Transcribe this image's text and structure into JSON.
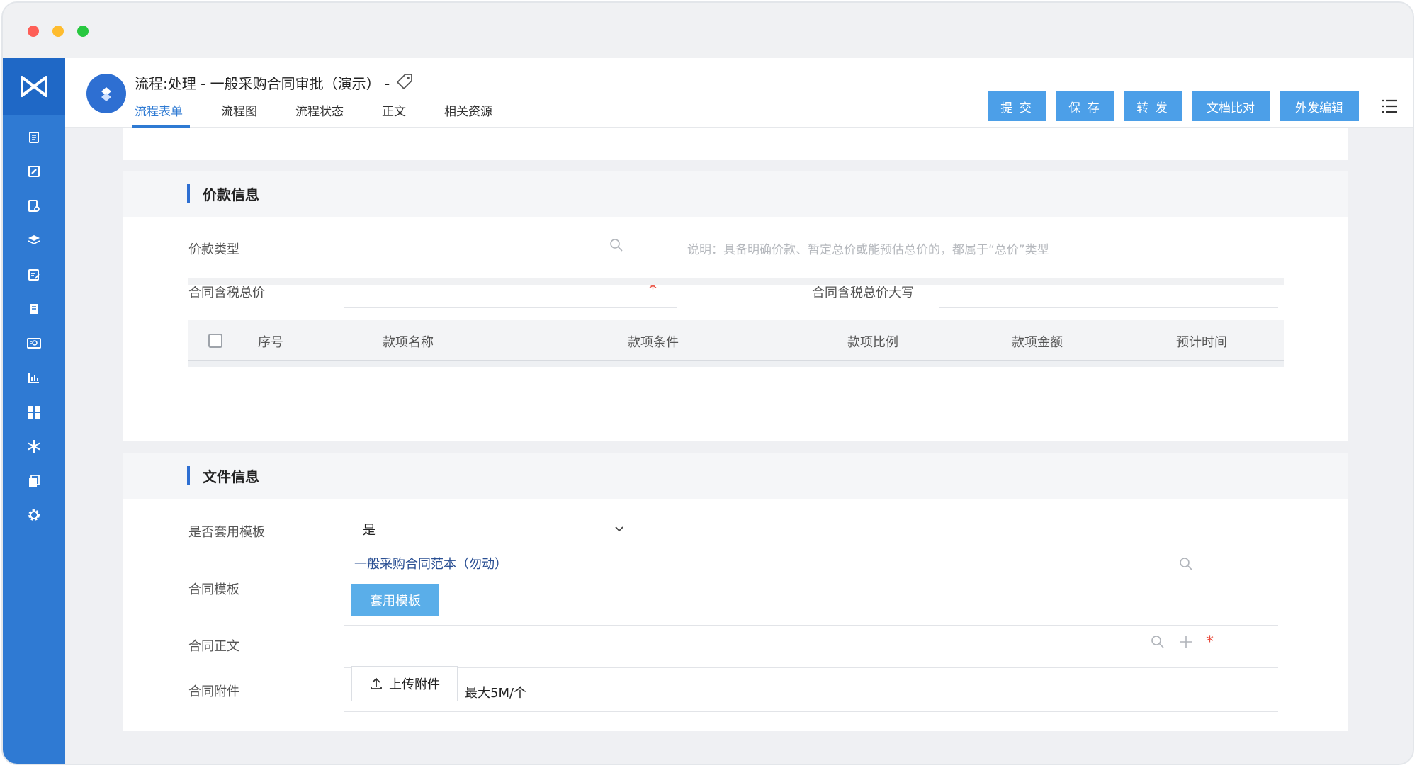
{
  "header": {
    "title": "流程:处理 - 一般采购合同审批（演示） -",
    "tabs": [
      {
        "label": "流程表单",
        "active": true
      },
      {
        "label": "流程图"
      },
      {
        "label": "流程状态"
      },
      {
        "label": "正文"
      },
      {
        "label": "相关资源"
      }
    ],
    "buttons": [
      {
        "label": "提 交"
      },
      {
        "label": "保 存"
      },
      {
        "label": "转 发"
      },
      {
        "label": "文档比对"
      },
      {
        "label": "外发编辑"
      }
    ]
  },
  "price_section": {
    "title": "价款信息",
    "price_type_label": "价款类型",
    "price_type_hint": "说明：具备明确价款、暂定总价或能预估总价的，都属于“总价”类型",
    "total_label": "合同含税总价",
    "total_upper_label": "合同含税总价大写",
    "required_mark": "*",
    "table_columns": [
      "序号",
      "款项名称",
      "款项条件",
      "款项比例",
      "款项金额",
      "预计时间"
    ]
  },
  "file_section": {
    "title": "文件信息",
    "use_template_label": "是否套用模板",
    "use_template_value": "是",
    "template_label": "合同模板",
    "template_value": "一般采购合同范本（勿动）",
    "apply_template_button": "套用模板",
    "body_label": "合同正文",
    "required_mark": "*",
    "attachment_label": "合同附件",
    "upload_button": "上传附件",
    "upload_limit": "最大5M/个"
  },
  "colors": {
    "sidebar": "#2f7ad3",
    "accent": "#2e7ad3",
    "button": "#4c9fe8",
    "required": "#e94a3b"
  },
  "sidebar_icons": [
    "doc-icon",
    "edit-icon",
    "doc-search-icon",
    "layers-icon",
    "edit-note-icon",
    "book-icon",
    "monitor-search-icon",
    "bar-chart-icon",
    "grid-icon",
    "snowflake-icon",
    "copy-icon",
    "settings-icon"
  ]
}
